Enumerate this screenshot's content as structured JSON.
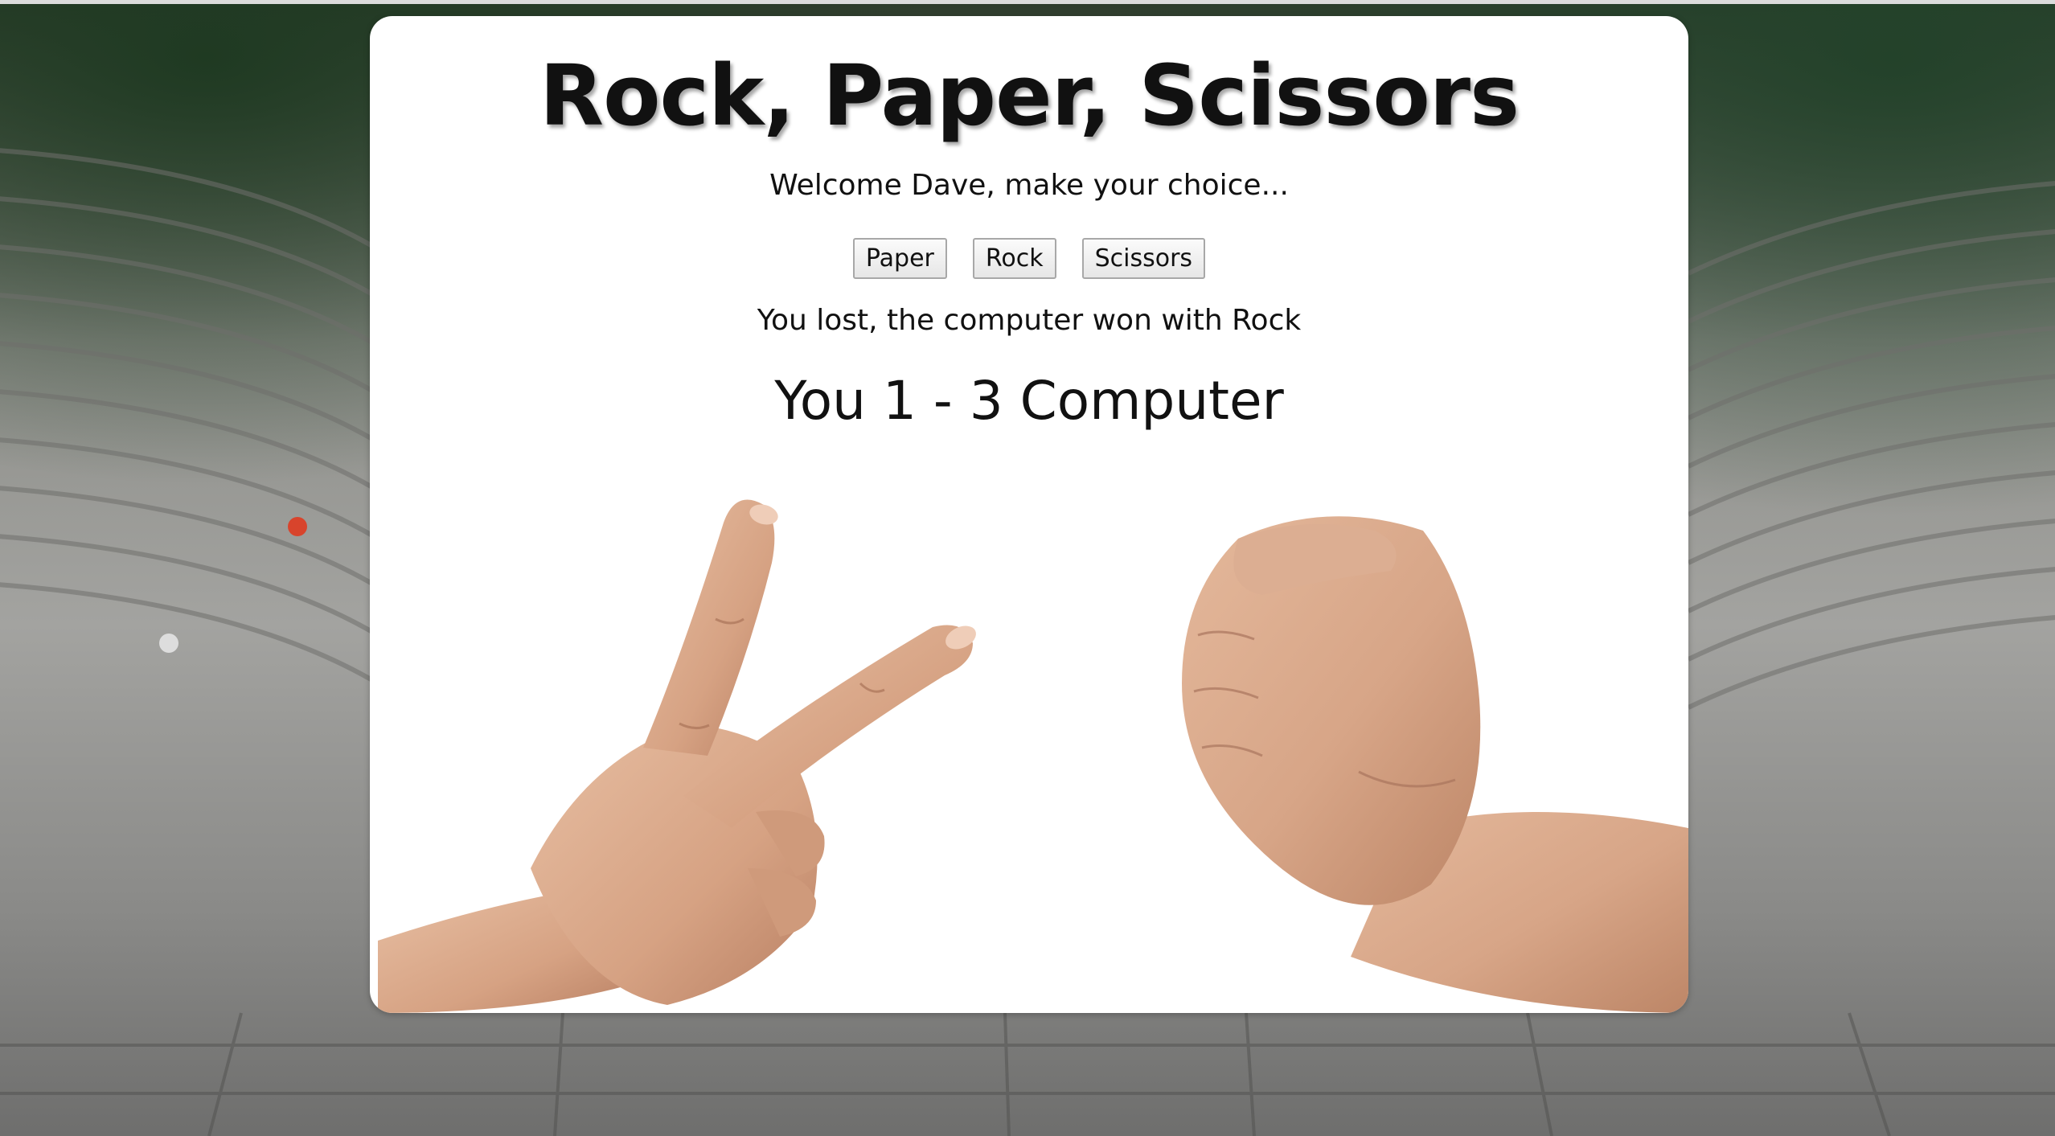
{
  "game": {
    "title": "Rock, Paper, Scissors",
    "welcome_message": "Welcome Dave, make your choice...",
    "choices": [
      "Paper",
      "Rock",
      "Scissors"
    ],
    "result_message": "You lost, the computer won with Rock",
    "score": {
      "text": "You 1 - 3 Computer",
      "player": 1,
      "computer": 3
    },
    "player_hand": "scissors-hand",
    "computer_hand": "rock-fist-hand"
  },
  "background": {
    "scene": "ancient-amphitheater-photo"
  },
  "colors": {
    "card_background": "#ffffff",
    "text": "#111111",
    "button_border": "#a8a8a8",
    "skin": "#d9a98a"
  }
}
